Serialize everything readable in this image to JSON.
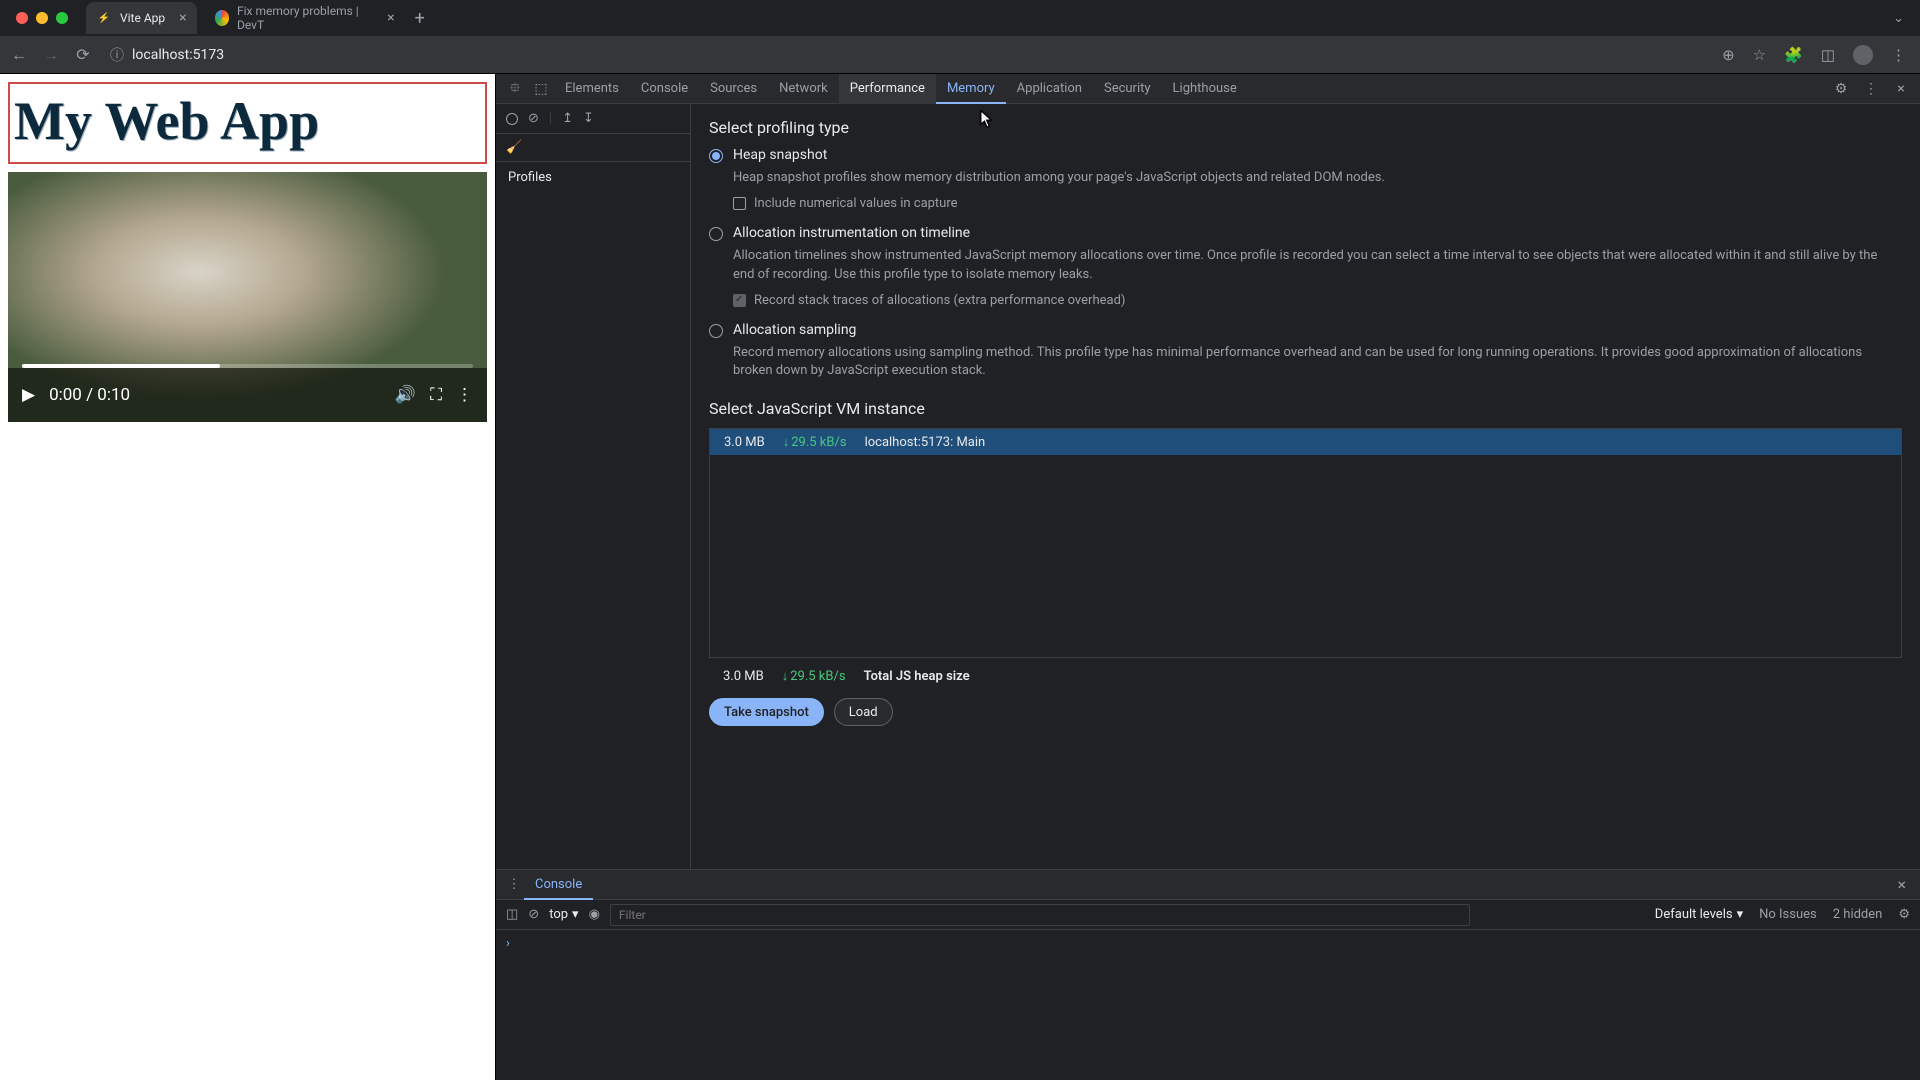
{
  "tabs": [
    {
      "title": "Vite App",
      "favicon": "⚡"
    },
    {
      "title": "Fix memory problems  |  DevT",
      "favicon": "◉"
    }
  ],
  "url": "localhost:5173",
  "page": {
    "heading": "My Web App",
    "video_time": "0:00 / 0:10"
  },
  "devtools_tabs": [
    "Elements",
    "Console",
    "Sources",
    "Network",
    "Performance",
    "Memory",
    "Application",
    "Security",
    "Lighthouse"
  ],
  "profiles_header": "Profiles",
  "memory": {
    "select_type_h": "Select profiling type",
    "opts": {
      "heap": {
        "label": "Heap snapshot",
        "desc": "Heap snapshot profiles show memory distribution among your page's JavaScript objects and related DOM nodes.",
        "chk": "Include numerical values in capture"
      },
      "timeline": {
        "label": "Allocation instrumentation on timeline",
        "desc": "Allocation timelines show instrumented JavaScript memory allocations over time. Once profile is recorded you can select a time interval to see objects that were allocated within it and still alive by the end of recording. Use this profile type to isolate memory leaks.",
        "chk": "Record stack traces of allocations (extra performance overhead)"
      },
      "sampling": {
        "label": "Allocation sampling",
        "desc": "Record memory allocations using sampling method. This profile type has minimal performance overhead and can be used for long running operations. It provides good approximation of allocations broken down by JavaScript execution stack."
      }
    },
    "vm_h": "Select JavaScript VM instance",
    "vm_row": {
      "size": "3.0 MB",
      "rate": "29.5 kB/s",
      "name": "localhost:5173: Main"
    },
    "total": {
      "size": "3.0 MB",
      "rate": "29.5 kB/s",
      "label": "Total JS heap size"
    },
    "take_btn": "Take snapshot",
    "load_btn": "Load"
  },
  "drawer": {
    "tab": "Console",
    "context": "top",
    "filter_ph": "Filter",
    "levels": "Default levels",
    "issues": "No Issues",
    "hidden": "2 hidden"
  }
}
